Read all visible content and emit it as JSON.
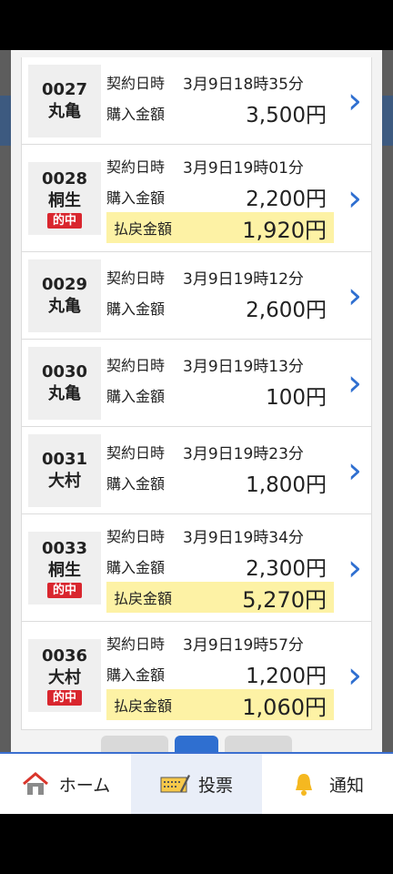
{
  "labels": {
    "contract_time": "契約日時",
    "purchase": "購入金額",
    "payout": "払戻金額",
    "win_badge": "的中"
  },
  "rows": [
    {
      "num": "0027",
      "venue": "丸亀",
      "win": false,
      "datetime": "3月9日18時35分",
      "purchase": "3,500円"
    },
    {
      "num": "0028",
      "venue": "桐生",
      "win": true,
      "datetime": "3月9日19時01分",
      "purchase": "2,200円",
      "payout": "1,920円"
    },
    {
      "num": "0029",
      "venue": "丸亀",
      "win": false,
      "datetime": "3月9日19時12分",
      "purchase": "2,600円"
    },
    {
      "num": "0030",
      "venue": "丸亀",
      "win": false,
      "datetime": "3月9日19時13分",
      "purchase": "100円"
    },
    {
      "num": "0031",
      "venue": "大村",
      "win": false,
      "datetime": "3月9日19時23分",
      "purchase": "1,800円"
    },
    {
      "num": "0033",
      "venue": "桐生",
      "win": true,
      "datetime": "3月9日19時34分",
      "purchase": "2,300円",
      "payout": "5,270円"
    },
    {
      "num": "0036",
      "venue": "大村",
      "win": true,
      "datetime": "3月9日19時57分",
      "purchase": "1,200円",
      "payout": "1,060円"
    }
  ],
  "nav": [
    {
      "label": "ホーム",
      "icon": "home-icon",
      "active": false
    },
    {
      "label": "投票",
      "icon": "ticket-pen-icon",
      "active": true
    },
    {
      "label": "通知",
      "icon": "bell-icon",
      "active": false
    }
  ],
  "colors": {
    "accent": "#2f6fd0",
    "win_badge": "#d9262e",
    "payout_bg": "#fdf2a5"
  }
}
